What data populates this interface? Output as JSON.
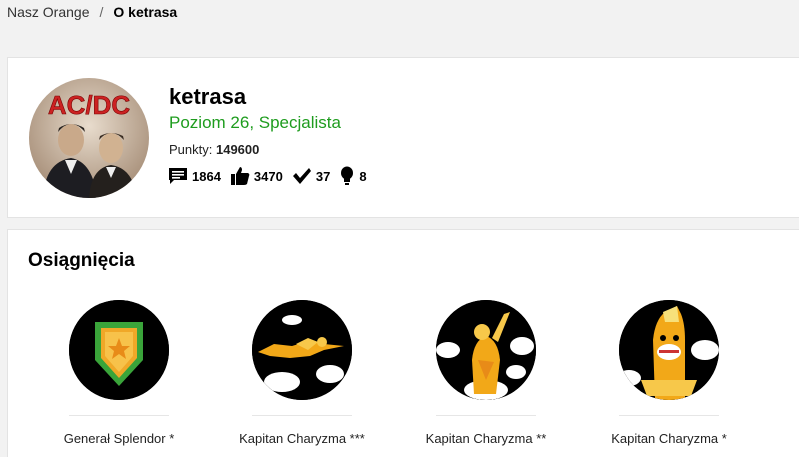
{
  "breadcrumb": {
    "home": "Nasz Orange",
    "separator": "/",
    "current": "O ketrasa"
  },
  "profile": {
    "avatar_text": "AC/DC",
    "username": "ketrasa",
    "level": "Poziom 26, Specjalista",
    "points_label": "Punkty:",
    "points_value": "149600",
    "stats": {
      "comments": "1864",
      "likes": "3470",
      "solutions": "37",
      "ideas": "8"
    },
    "level_color": "#1e9c1e"
  },
  "achievements": {
    "title": "Osiągnięcia",
    "items": [
      {
        "name": "Generał Splendor *",
        "icon": "shield-star-icon"
      },
      {
        "name": "Kapitan Charyzma ***",
        "icon": "flying-hero-icon"
      },
      {
        "name": "Kapitan Charyzma **",
        "icon": "rising-hero-icon"
      },
      {
        "name": "Kapitan Charyzma *",
        "icon": "smiling-hero-icon"
      }
    ]
  }
}
